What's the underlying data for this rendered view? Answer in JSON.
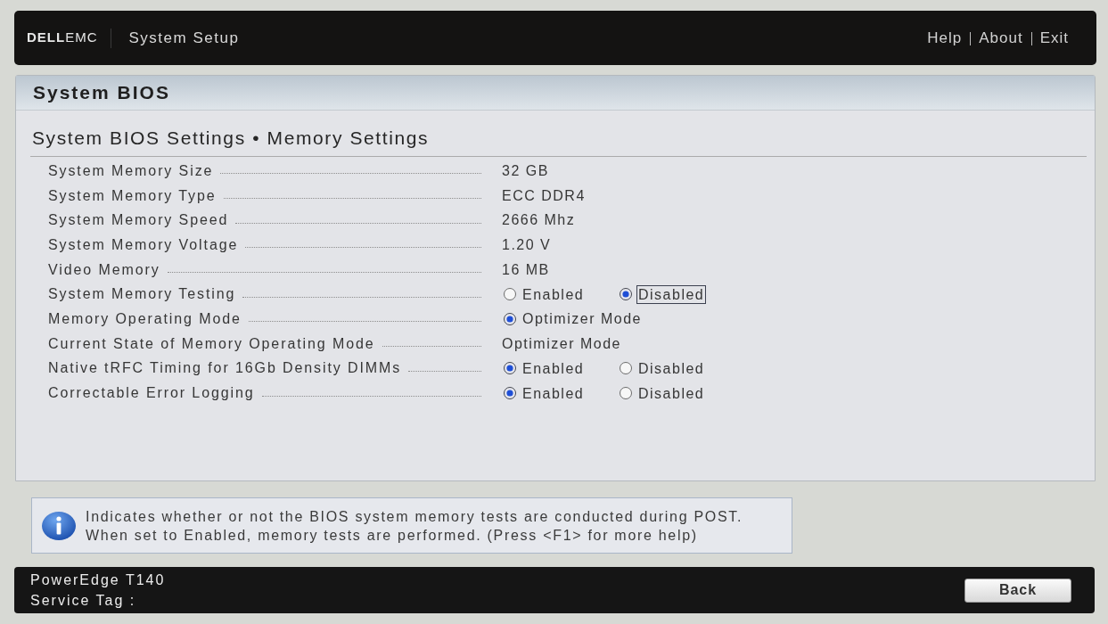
{
  "header": {
    "logo": {
      "brand": "DELL",
      "suffix": "EMC"
    },
    "title": "System Setup",
    "links": [
      "Help",
      "About",
      "Exit"
    ]
  },
  "panel": {
    "title": "System BIOS",
    "section_title": "System BIOS Settings • Memory Settings",
    "rows": [
      {
        "label": "System Memory Size",
        "kind": "value",
        "value": "32 GB"
      },
      {
        "label": "System Memory Type",
        "kind": "value",
        "value": "ECC DDR4"
      },
      {
        "label": "System Memory Speed",
        "kind": "value",
        "value": "2666 Mhz"
      },
      {
        "label": "System Memory Voltage",
        "kind": "value",
        "value": "1.20 V"
      },
      {
        "label": "Video Memory",
        "kind": "value",
        "value": "16 MB"
      },
      {
        "label": "System Memory Testing",
        "kind": "radio",
        "options": [
          {
            "label": "Enabled",
            "selected": false,
            "focused": false
          },
          {
            "label": "Disabled",
            "selected": true,
            "focused": true
          }
        ]
      },
      {
        "label": "Memory Operating Mode",
        "kind": "radio",
        "options": [
          {
            "label": "Optimizer Mode",
            "selected": true,
            "focused": false
          }
        ]
      },
      {
        "label": "Current State of Memory Operating Mode",
        "kind": "value",
        "value": "Optimizer Mode"
      },
      {
        "label": "Native tRFC Timing for 16Gb Density DIMMs",
        "kind": "radio",
        "options": [
          {
            "label": "Enabled",
            "selected": true,
            "focused": false
          },
          {
            "label": "Disabled",
            "selected": false,
            "focused": false
          }
        ]
      },
      {
        "label": "Correctable Error Logging",
        "kind": "radio",
        "options": [
          {
            "label": "Enabled",
            "selected": true,
            "focused": false
          },
          {
            "label": "Disabled",
            "selected": false,
            "focused": false
          }
        ]
      }
    ]
  },
  "help": {
    "lines": [
      "Indicates whether or not the BIOS system memory tests are conducted during POST.",
      "When set to Enabled, memory tests are performed. (Press <F1> for more help)"
    ]
  },
  "footer": {
    "model": "PowerEdge T140",
    "service_tag_label": "Service Tag :",
    "back_button": "Back"
  }
}
